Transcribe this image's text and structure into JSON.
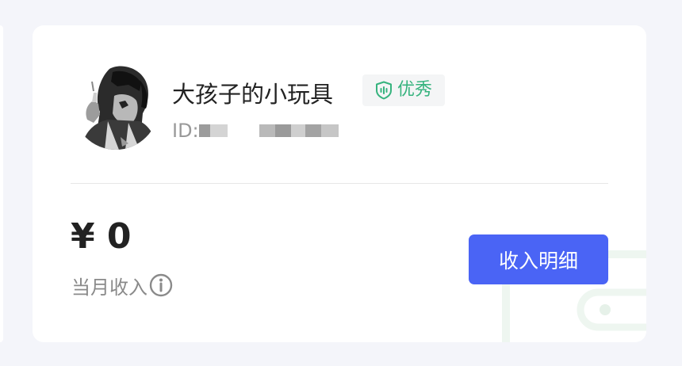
{
  "profile": {
    "name": "大孩子的小玩具",
    "badge_label": "优秀",
    "id_label": "ID:",
    "avatar_icon": "avatar-photo",
    "badge_icon": "shield-icon"
  },
  "income": {
    "amount": "¥ 0",
    "label": "当月收入",
    "info_icon": "info-icon",
    "detail_button_label": "收入明细"
  },
  "colors": {
    "accent": "#4a64f5",
    "badge_green": "#36b37e",
    "card_bg": "#ffffff",
    "page_bg": "#f4f5fa"
  }
}
